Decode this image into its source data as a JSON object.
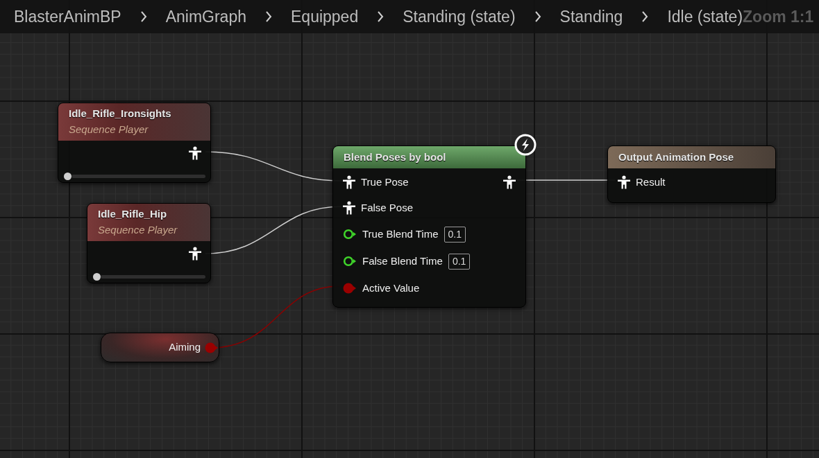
{
  "breadcrumb": {
    "items": [
      "BlasterAnimBP",
      "AnimGraph",
      "Equipped",
      "Standing (state)",
      "Standing",
      "Idle (state)"
    ],
    "zoom": "Zoom 1:1"
  },
  "nodes": [
    {
      "kind": "sequence_player",
      "title": "Idle_Rifle_Ironsights",
      "subtitle": "Sequence Player",
      "level": 0
    },
    {
      "kind": "sequence_player",
      "title": "Idle_Rifle_Hip",
      "subtitle": "Sequence Player",
      "level": 0
    },
    {
      "kind": "blend",
      "title": "Blend Poses by bool",
      "fast_path": true,
      "pins": [
        {
          "kind": "pose",
          "label": "True Pose"
        },
        {
          "kind": "pose",
          "label": "False Pose"
        },
        {
          "kind": "float",
          "label": "True Blend Time",
          "value": "0.1"
        },
        {
          "kind": "float",
          "label": "False Blend Time",
          "value": "0.1"
        },
        {
          "kind": "bool",
          "label": "Active Value"
        }
      ]
    },
    {
      "kind": "output",
      "title": "Output Animation Pose",
      "pins": [
        {
          "kind": "pose",
          "label": "Result"
        }
      ]
    },
    {
      "kind": "variable",
      "title": "Aiming"
    }
  ]
}
